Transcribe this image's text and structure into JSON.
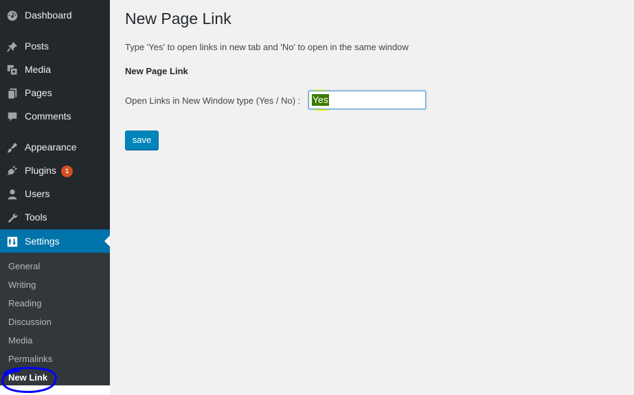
{
  "sidebar": {
    "items": [
      {
        "label": "Dashboard",
        "icon": "dashboard-icon"
      },
      {
        "label": "Posts",
        "icon": "pin-icon"
      },
      {
        "label": "Media",
        "icon": "media-icon"
      },
      {
        "label": "Pages",
        "icon": "pages-icon"
      },
      {
        "label": "Comments",
        "icon": "comment-icon"
      },
      {
        "label": "Appearance",
        "icon": "brush-icon"
      },
      {
        "label": "Plugins",
        "icon": "plug-icon",
        "badge": "1"
      },
      {
        "label": "Users",
        "icon": "user-icon"
      },
      {
        "label": "Tools",
        "icon": "wrench-icon"
      },
      {
        "label": "Settings",
        "icon": "settings-icon",
        "active": true
      }
    ],
    "submenu": [
      "General",
      "Writing",
      "Reading",
      "Discussion",
      "Media",
      "Permalinks",
      "New Link"
    ],
    "current_submenu": "New Link"
  },
  "main": {
    "title": "New Page Link",
    "instructions": "Type 'Yes' to open links in new tab and 'No' to open in the same window",
    "section_title": "New Page Link",
    "field_label": "Open Links in New Window type (Yes / No) :",
    "field_value": "Yes",
    "save_label": "save"
  },
  "colors": {
    "sidebar_bg": "#23282d",
    "submenu_bg": "#32373c",
    "accent": "#0073aa",
    "button": "#0085ba",
    "badge": "#d54e21",
    "annotation_highlight": "#ffff00",
    "annotation_circle": "#0000ff"
  }
}
